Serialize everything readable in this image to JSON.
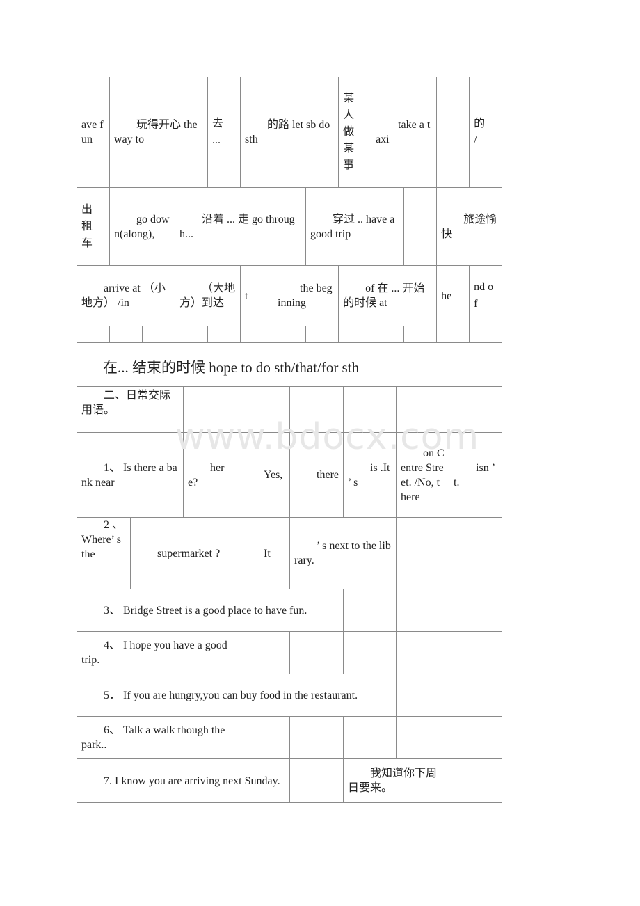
{
  "table1": {
    "row1": {
      "c1": "ave fun",
      "c2": "玩得开心 the way to",
      "c3": "去 ...",
      "c4": "的路 let sb do sth",
      "c5": "某人做某事",
      "c6": "take a taxi",
      "c7": "",
      "c8": "的 /"
    },
    "row2": {
      "c1": "出租车",
      "c2": "go down(along),",
      "c3": "沿着 ... 走 go through...",
      "c4": "穿过 .. have a good trip",
      "c5": "",
      "c6": "旅途愉快"
    },
    "row3": {
      "c1": "arrive at （小地方） /in",
      "c2": "（大地方）到达",
      "c3": "t",
      "c4": "the beginning",
      "c5": "of 在 ... 开始的时候 at",
      "c6": "he",
      "c7": "nd of"
    }
  },
  "middle_line": "在... 结束的时候 hope to do sth/that/for sth",
  "watermark": "www.bdocx.com",
  "table2": {
    "heading": "二、日常交际用语。",
    "q1": {
      "c1": "1、 Is there a bank near",
      "c2": "here?",
      "c3": "Yes,",
      "c4": "there",
      "c5": "is .It ’ s",
      "c6": "on Centre Street. /No, there",
      "c7": "isn ’ t."
    },
    "q2": {
      "c1": "2 、Where’ s the",
      "c2": "supermarket ?",
      "c3": "It",
      "c4": "’ s next to the library."
    },
    "q3": "3、 Bridge Street is a good place to have fun.",
    "q4": "4、 I hope you have a good trip.",
    "q5": "5． If you are hungry,you can buy food in the restaurant.",
    "q6": "6、 Talk a walk though the park..",
    "q7": {
      "c1": "7. I know you are arriving next Sunday.",
      "c2": "我知道你下周日要来。"
    }
  }
}
